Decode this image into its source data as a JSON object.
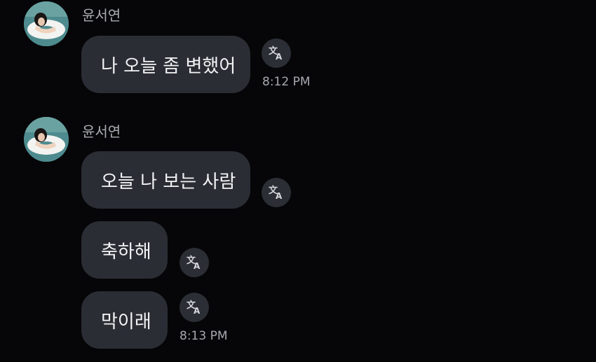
{
  "colors": {
    "background": "#060608",
    "bubble": "#2a2e34",
    "bubble_text": "#f2f3f5",
    "secondary_text": "#a9acb0",
    "translate_button": "#2b2f35"
  },
  "groups": [
    {
      "sender": "윤서연",
      "avatar_icon": "profile-photo",
      "messages": [
        {
          "text": "나 오늘 좀 변했어",
          "time": "8:12 PM",
          "action_icon": "translate-icon"
        }
      ]
    },
    {
      "sender": "윤서연",
      "avatar_icon": "profile-photo",
      "messages": [
        {
          "text": "오늘 나 보는 사람",
          "time": "",
          "action_icon": "translate-icon"
        },
        {
          "text": "축하해",
          "time": "",
          "action_icon": "translate-icon"
        },
        {
          "text": "막이래",
          "time": "8:13 PM",
          "action_icon": "translate-icon"
        }
      ]
    }
  ]
}
